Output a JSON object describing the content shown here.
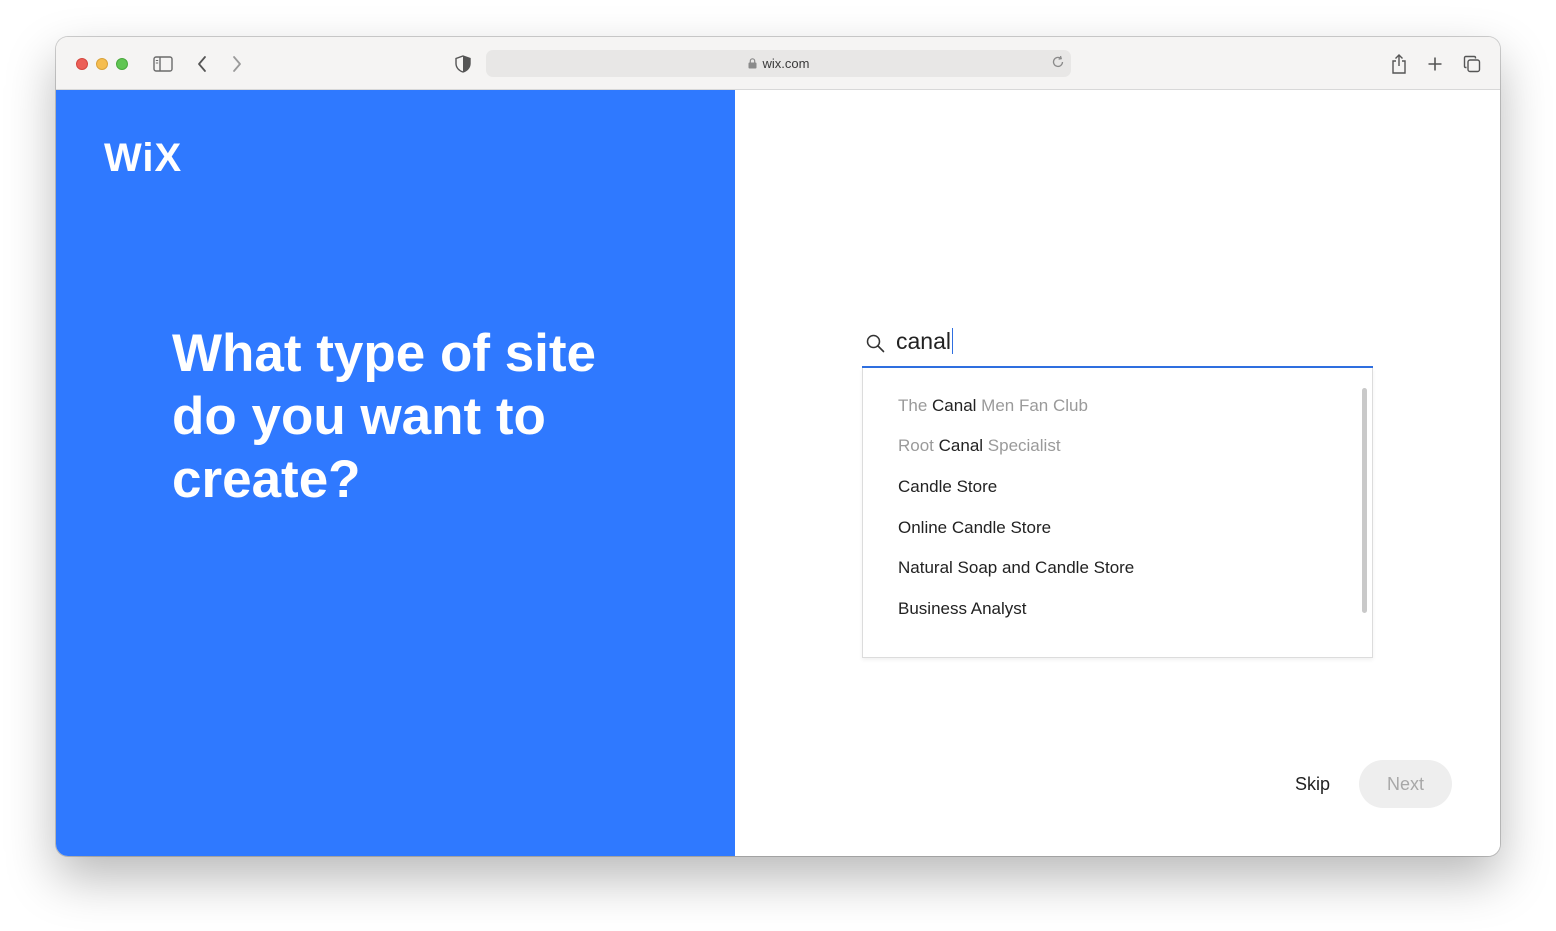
{
  "browser": {
    "url": "wix.com"
  },
  "left": {
    "logo": "WiX",
    "headline": "What type of site do you want to create?"
  },
  "search": {
    "query": "canal"
  },
  "suggestions": [
    {
      "pre": "The ",
      "match": "Canal",
      "post": " Men Fan Club"
    },
    {
      "pre": "Root ",
      "match": "Canal",
      "post": " Specialist"
    },
    {
      "pre": "",
      "match": "Candle Store",
      "post": ""
    },
    {
      "pre": "",
      "match": "Online Candle Store",
      "post": ""
    },
    {
      "pre": "",
      "match": "Natural Soap and Candle Store",
      "post": ""
    },
    {
      "pre": "",
      "match": "Business Analyst",
      "post": ""
    }
  ],
  "actions": {
    "skip": "Skip",
    "next": "Next"
  },
  "colors": {
    "brand_blue": "#2f79ff",
    "input_underline": "#2f6fe0"
  }
}
